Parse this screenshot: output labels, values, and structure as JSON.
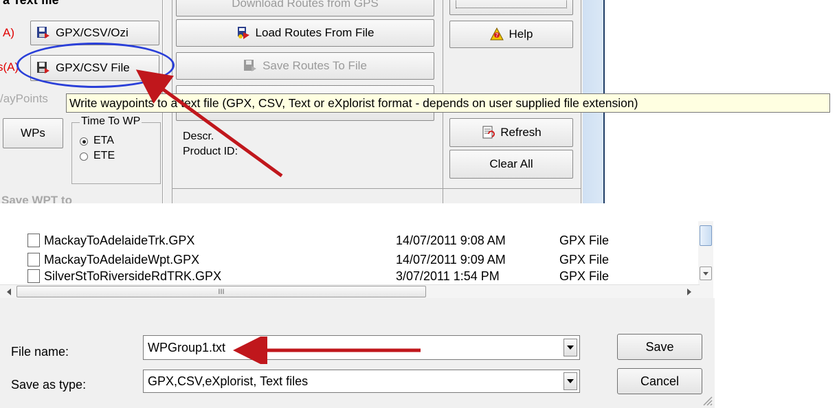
{
  "top": {
    "title_fragment": "a Text file",
    "label_a": "A)",
    "label_s": "s(A)",
    "waypoints_label": "/ayPoints",
    "btn_gpx_ozi": "GPX/CSV/Ozi",
    "btn_gpx_csv_file": "GPX/CSV File",
    "btn_download_routes": "Download Routes from GPS",
    "btn_load_routes": "Load Routes From File",
    "btn_save_routes": "Save Routes To File",
    "btn_help": "Help",
    "btn_refresh": "Refresh",
    "btn_clear_all": "Clear All",
    "btn_wps": "WPs",
    "time_to_wp_legend": "Time To WP",
    "radio_eta": "ETA",
    "radio_ete": "ETE",
    "descr_label": "Descr.",
    "product_id_label": "Product ID:",
    "save_wpt_label": "Save WPT to",
    "tooltip": "Write waypoints to a text file (GPX, CSV, Text or eXplorist format - depends on user supplied file extension)"
  },
  "dialog": {
    "files": [
      {
        "name": "MackayToAdelaideTrk.GPX",
        "date": "14/07/2011 9:08 AM",
        "type": "GPX File"
      },
      {
        "name": "MackayToAdelaideWpt.GPX",
        "date": "14/07/2011 9:09 AM",
        "type": "GPX File"
      },
      {
        "name": "SilverStToRiversideRdTRK.GPX",
        "date": "3/07/2011 1:54 PM",
        "type": "GPX File"
      }
    ],
    "scroll_grip": "III",
    "file_name_label": "File name:",
    "file_name_value": "WPGroup1.txt",
    "save_as_type_label": "Save as type:",
    "save_as_type_value": "GPX,CSV,eXplorist, Text files",
    "save_button": "Save",
    "cancel_button": "Cancel"
  },
  "colors": {
    "annotation_arrow": "#c0171c",
    "highlight_ellipse": "#2a3fd8",
    "tooltip_bg": "#ffffe1"
  }
}
